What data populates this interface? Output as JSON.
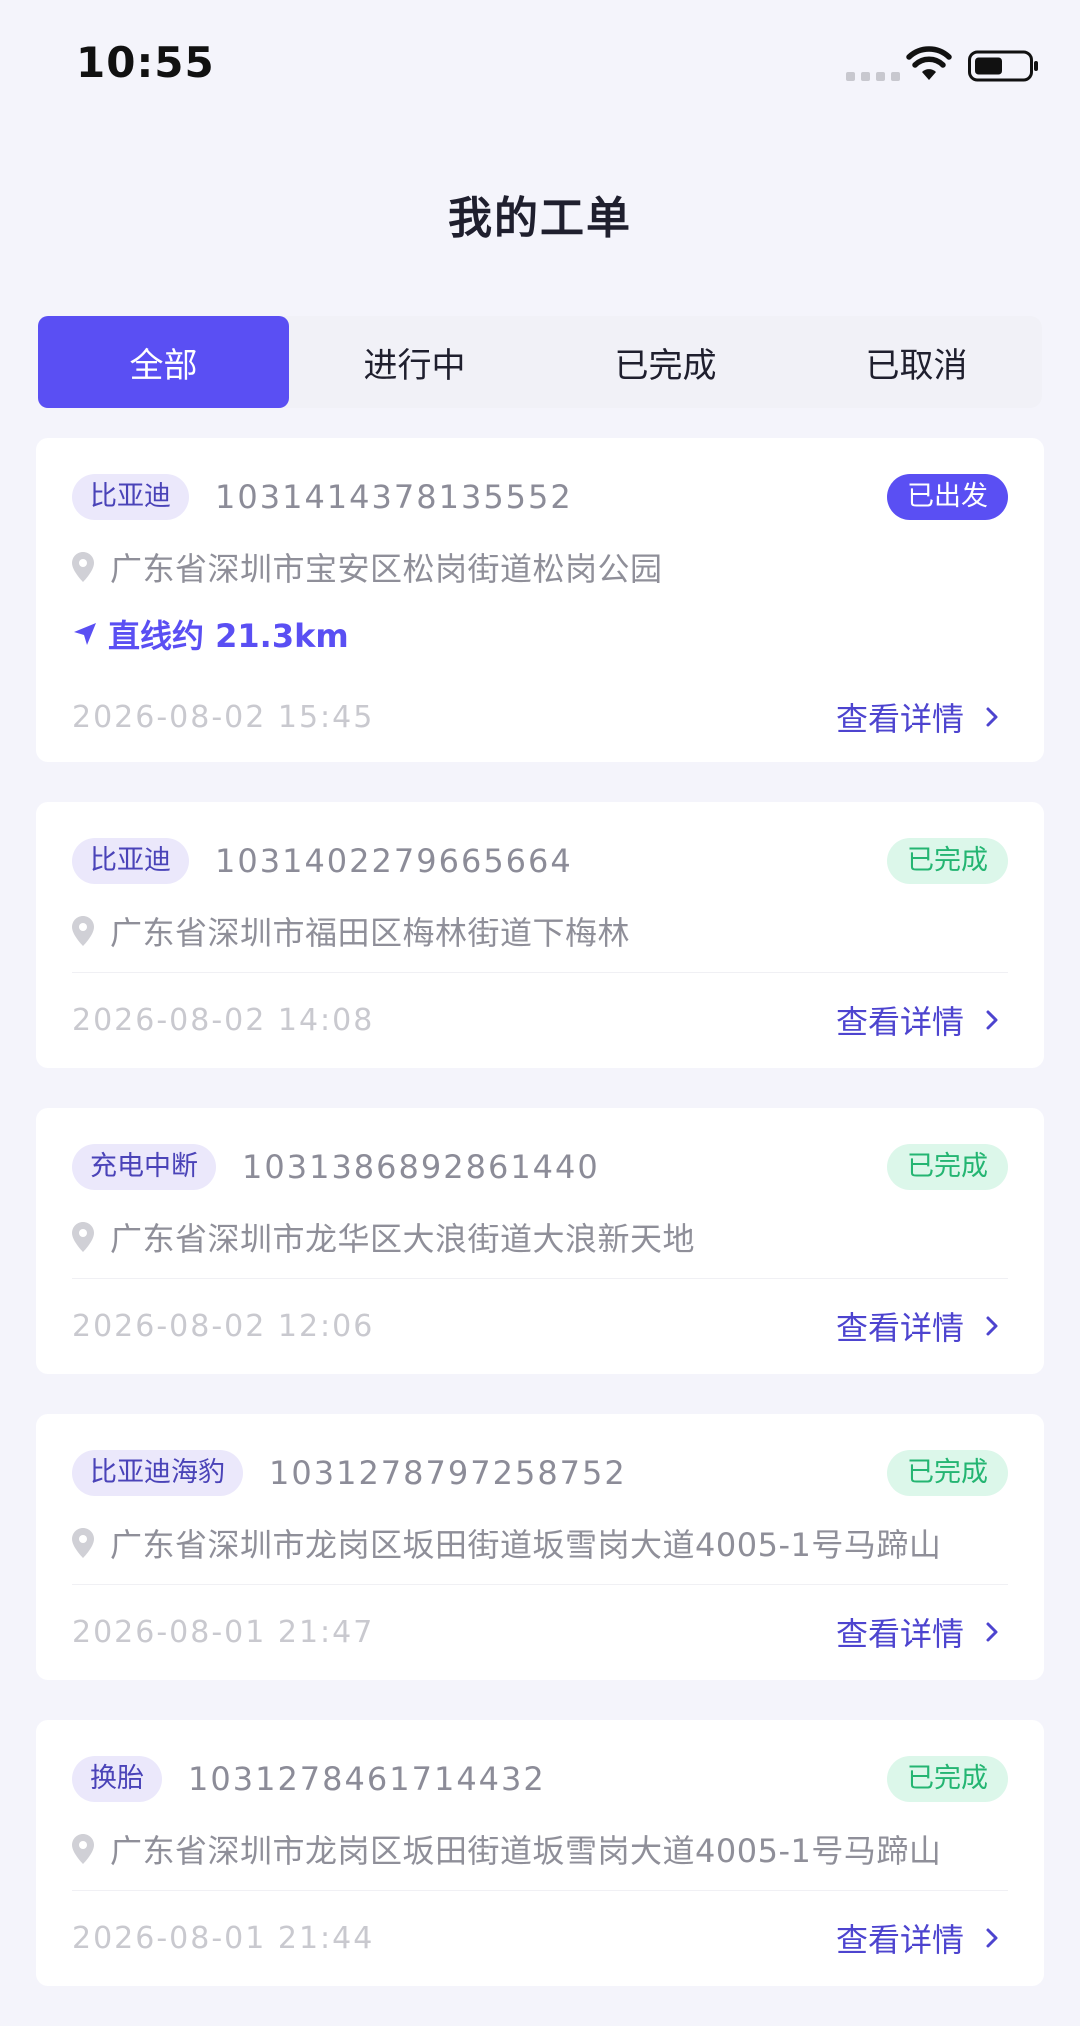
{
  "status_bar": {
    "time": "10:55"
  },
  "header": {
    "title": "我的工单"
  },
  "tabs": [
    {
      "label": "全部",
      "active": true
    },
    {
      "label": "进行中",
      "active": false
    },
    {
      "label": "已完成",
      "active": false
    },
    {
      "label": "已取消",
      "active": false
    }
  ],
  "colors": {
    "accent": "#5a4ff3",
    "done_bg": "#dcf7ea",
    "done_text": "#24b572"
  },
  "orders": [
    {
      "type": "比亚迪",
      "order_no": "1031414378135552",
      "status": "已出发",
      "address": "广东省深圳市宝安区松岗街道松岗公园",
      "distance": "直线约 21.3km",
      "time": "2026-08-02 15:45",
      "detail_label": "查看详情"
    },
    {
      "type": "比亚迪",
      "order_no": "1031402279665664",
      "status": "已完成",
      "address": "广东省深圳市福田区梅林街道下梅林",
      "time": "2026-08-02 14:08",
      "detail_label": "查看详情"
    },
    {
      "type": "充电中断",
      "order_no": "1031386892861440",
      "status": "已完成",
      "address": "广东省深圳市龙华区大浪街道大浪新天地",
      "time": "2026-08-02 12:06",
      "detail_label": "查看详情"
    },
    {
      "type": "比亚迪海豹",
      "order_no": "1031278797258752",
      "status": "已完成",
      "address": "广东省深圳市龙岗区坂田街道坂雪岗大道4005-1号马蹄山",
      "time": "2026-08-01 21:47",
      "detail_label": "查看详情"
    },
    {
      "type": "换胎",
      "order_no": "1031278461714432",
      "status": "已完成",
      "address": "广东省深圳市龙岗区坂田街道坂雪岗大道4005-1号马蹄山",
      "time": "2026-08-01 21:44",
      "detail_label": "查看详情"
    }
  ]
}
